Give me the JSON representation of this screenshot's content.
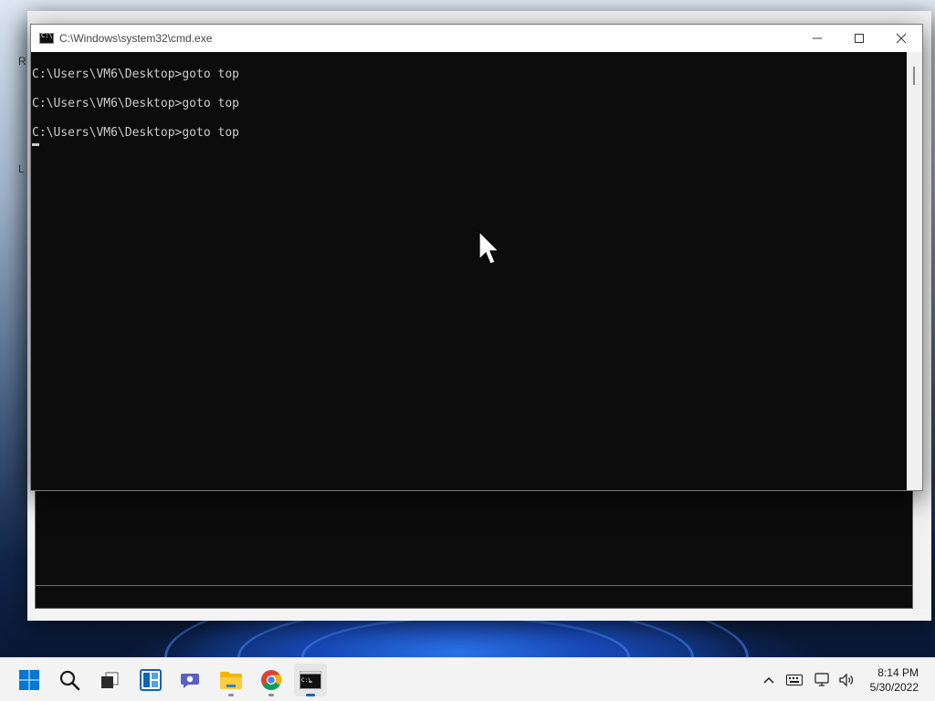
{
  "window": {
    "title": "C:\\Windows\\system32\\cmd.exe",
    "icon": "cmd-icon",
    "controls": {
      "minimize": "minimize-icon",
      "maximize": "maximize-icon",
      "close": "close-icon"
    }
  },
  "console": {
    "lines": [
      "C:\\Users\\VM6\\Desktop>goto top",
      "C:\\Users\\VM6\\Desktop>goto top",
      "C:\\Users\\VM6\\Desktop>goto top"
    ],
    "text_color": "#cccccc",
    "background_color": "#0c0c0c"
  },
  "background_window": {
    "edge_letters": [
      "R",
      "L"
    ]
  },
  "taskbar": {
    "items": [
      {
        "name": "start-button",
        "icon": "windows-logo-icon"
      },
      {
        "name": "search-button",
        "icon": "search-icon"
      },
      {
        "name": "task-view-button",
        "icon": "task-view-icon"
      },
      {
        "name": "widgets-button",
        "icon": "widgets-icon"
      },
      {
        "name": "chat-button",
        "icon": "teams-chat-icon"
      },
      {
        "name": "file-explorer-button",
        "icon": "folder-icon",
        "running": true
      },
      {
        "name": "chrome-button",
        "icon": "chrome-icon",
        "running": true
      },
      {
        "name": "cmd-button",
        "icon": "cmd-icon",
        "running": true
      }
    ],
    "tray": {
      "icons": [
        "chevron-up-icon",
        "keyboard-icon",
        "network-icon",
        "volume-icon"
      ],
      "time": "8:14 PM",
      "date": "5/30/2022"
    }
  },
  "colors": {
    "accent": "#0067c0",
    "taskbar": "#f3f3f3"
  }
}
